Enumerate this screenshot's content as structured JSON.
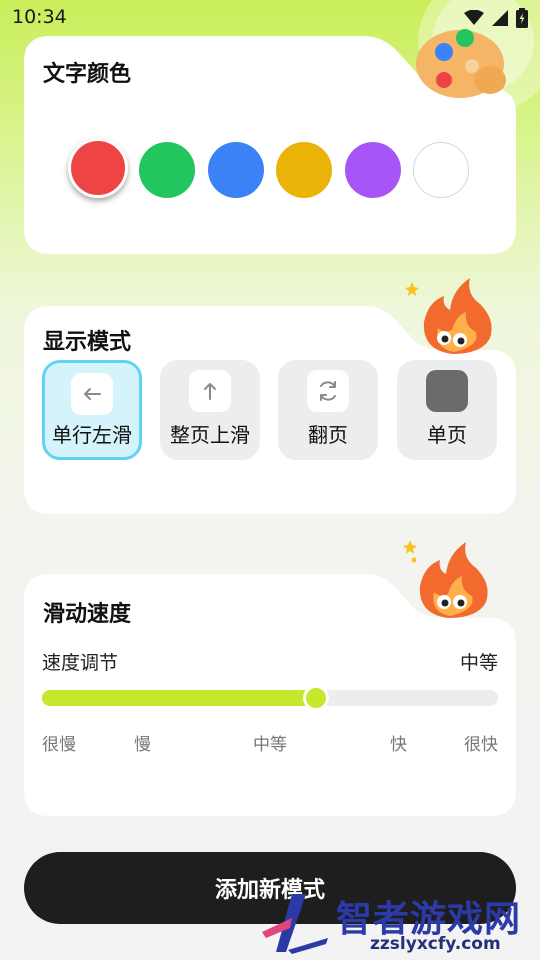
{
  "status_bar": {
    "time": "10:34"
  },
  "text_color": {
    "title": "文字颜色",
    "swatches": [
      {
        "name": "red",
        "color": "#ef4444",
        "selected": true
      },
      {
        "name": "green",
        "color": "#22c55e",
        "selected": false
      },
      {
        "name": "blue",
        "color": "#3b82f6",
        "selected": false
      },
      {
        "name": "yellow",
        "color": "#eab308",
        "selected": false
      },
      {
        "name": "purple",
        "color": "#a855f7",
        "selected": false
      },
      {
        "name": "white",
        "color": "#ffffff",
        "selected": false
      }
    ]
  },
  "display_mode": {
    "title": "显示模式",
    "modes": [
      {
        "label": "单行左滑",
        "icon": "arrow-left-icon",
        "active": true
      },
      {
        "label": "整页上滑",
        "icon": "arrow-up-icon",
        "active": false
      },
      {
        "label": "翻页",
        "icon": "refresh-icon",
        "active": false
      },
      {
        "label": "单页",
        "icon": "square-icon",
        "active": false
      }
    ]
  },
  "scroll_speed": {
    "title": "滑动速度",
    "adjust_label": "速度调节",
    "current_value": "中等",
    "level": 0.6,
    "ticks": [
      "很慢",
      "慢",
      "中等",
      "快",
      "很快"
    ],
    "accent_color": "#c3e82c"
  },
  "add_button": {
    "label": "添加新模式"
  },
  "watermark": {
    "text": "智者游戏网",
    "url": "zzslyxcfy.com"
  }
}
